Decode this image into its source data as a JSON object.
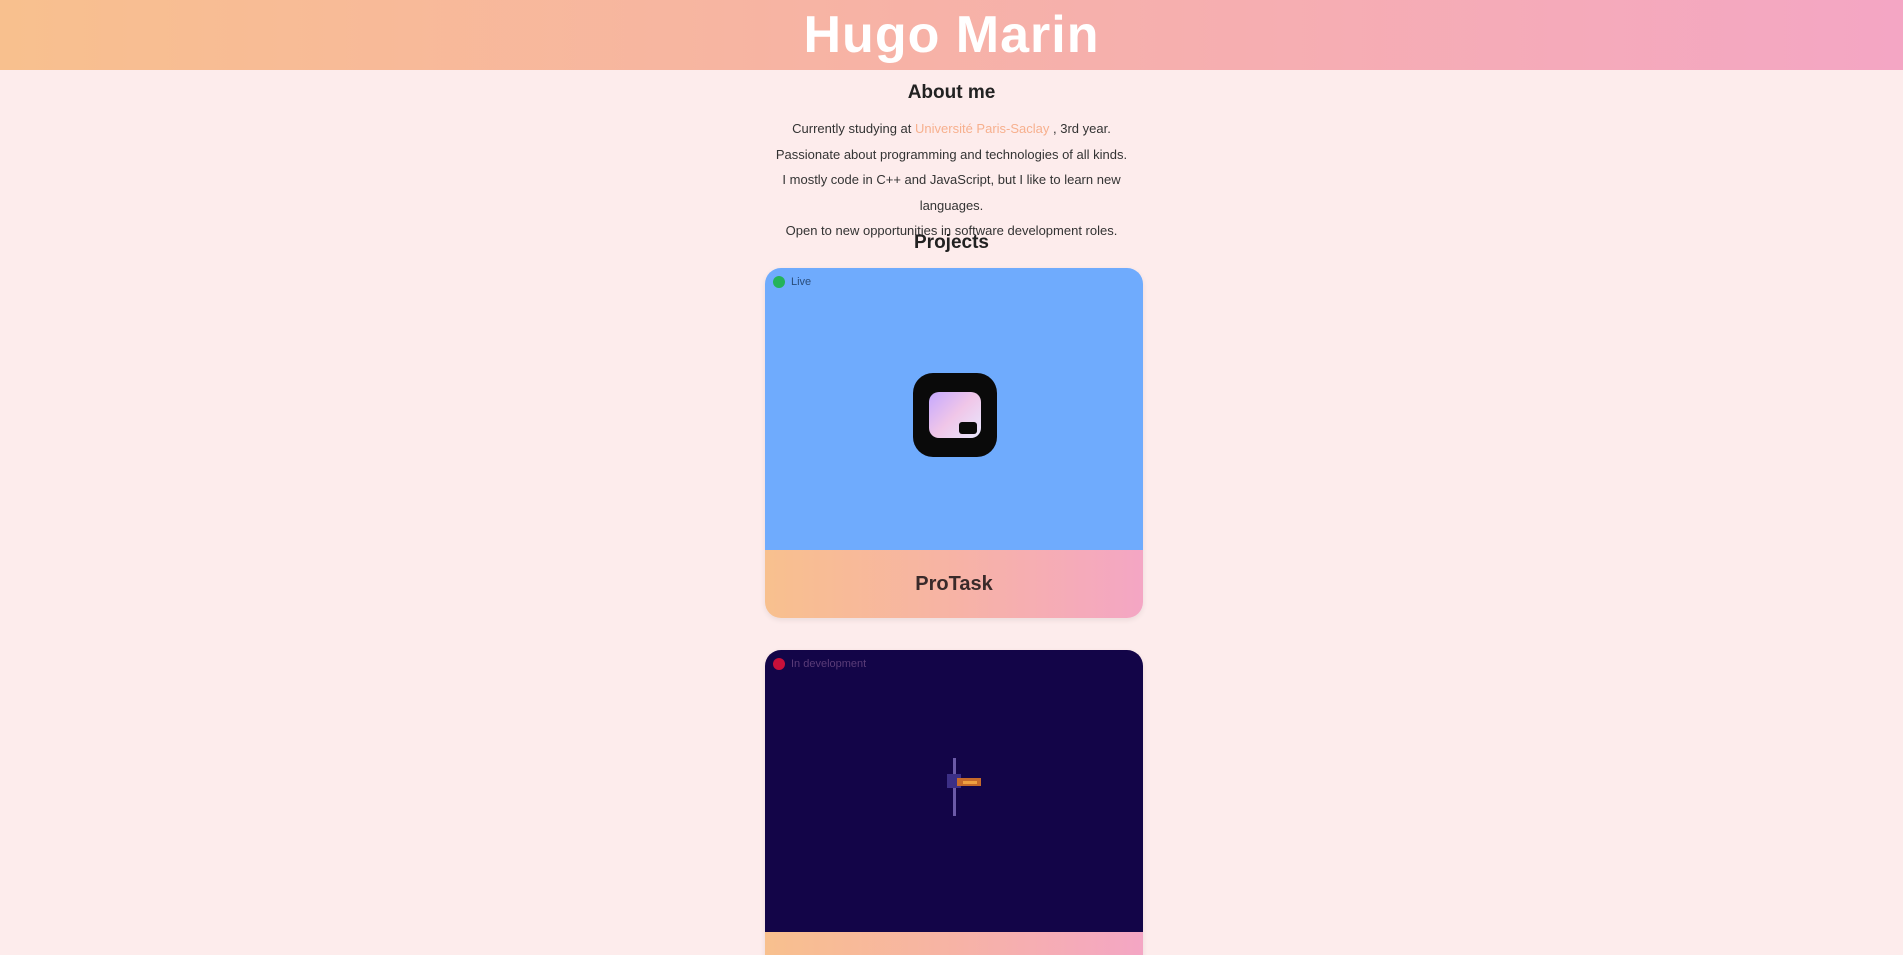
{
  "header": {
    "title": "Hugo Marin"
  },
  "about": {
    "title": "About me",
    "line1_pre": "Currently studying at",
    "line1_highlight": "Université Paris-Saclay",
    "line1_post": ", 3rd year.",
    "line2": "Passionate about programming and technologies of all kinds.",
    "line3": "I mostly code in C++ and JavaScript, but I like to learn new languages.",
    "line4": "Open to new opportunities in software development roles."
  },
  "projects": {
    "title": "Projects",
    "items": [
      {
        "name": "ProTask",
        "status": "Live",
        "status_color": "#24b35a",
        "media_color": "#6fabfd",
        "icon": "app-icon"
      },
      {
        "name": "",
        "status": "In development",
        "status_color": "#c8103a",
        "media_color": "#130548",
        "icon": "game-sprite-icon"
      }
    ]
  },
  "colors": {
    "accent_gradient_start": "#f8c08e",
    "accent_gradient_end": "#f4a6c4",
    "page_background": "#fdecec",
    "highlight": "#f7b08e"
  }
}
